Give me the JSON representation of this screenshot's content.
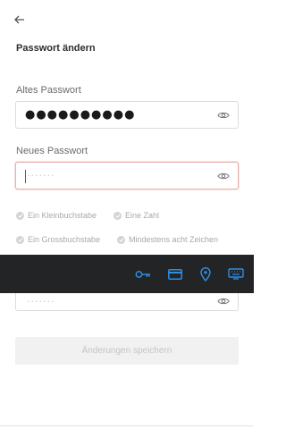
{
  "header": {
    "title": "Passwort ändern"
  },
  "old_password": {
    "label": "Altes Passwort",
    "value": "●●●●●●●●●●"
  },
  "new_password": {
    "label": "Neues Passwort",
    "placeholder": "·······"
  },
  "rules": [
    {
      "label": "Ein Kleinbuchstabe"
    },
    {
      "label": "Eine Zahl"
    },
    {
      "label": "Ein Grossbuchstabe"
    },
    {
      "label": "Mindestens acht Zeichen"
    }
  ],
  "confirm_password": {
    "placeholder": "·······"
  },
  "submit": {
    "label": "Änderungen speichern"
  },
  "toolbar": {
    "icons": [
      "key-icon",
      "credit-card-icon",
      "location-pin-icon",
      "keyboard-icon"
    ],
    "accent": "#2f8de4"
  },
  "colors": {
    "toolbar_bg": "#222426",
    "active_border": "#e7b2a6"
  }
}
